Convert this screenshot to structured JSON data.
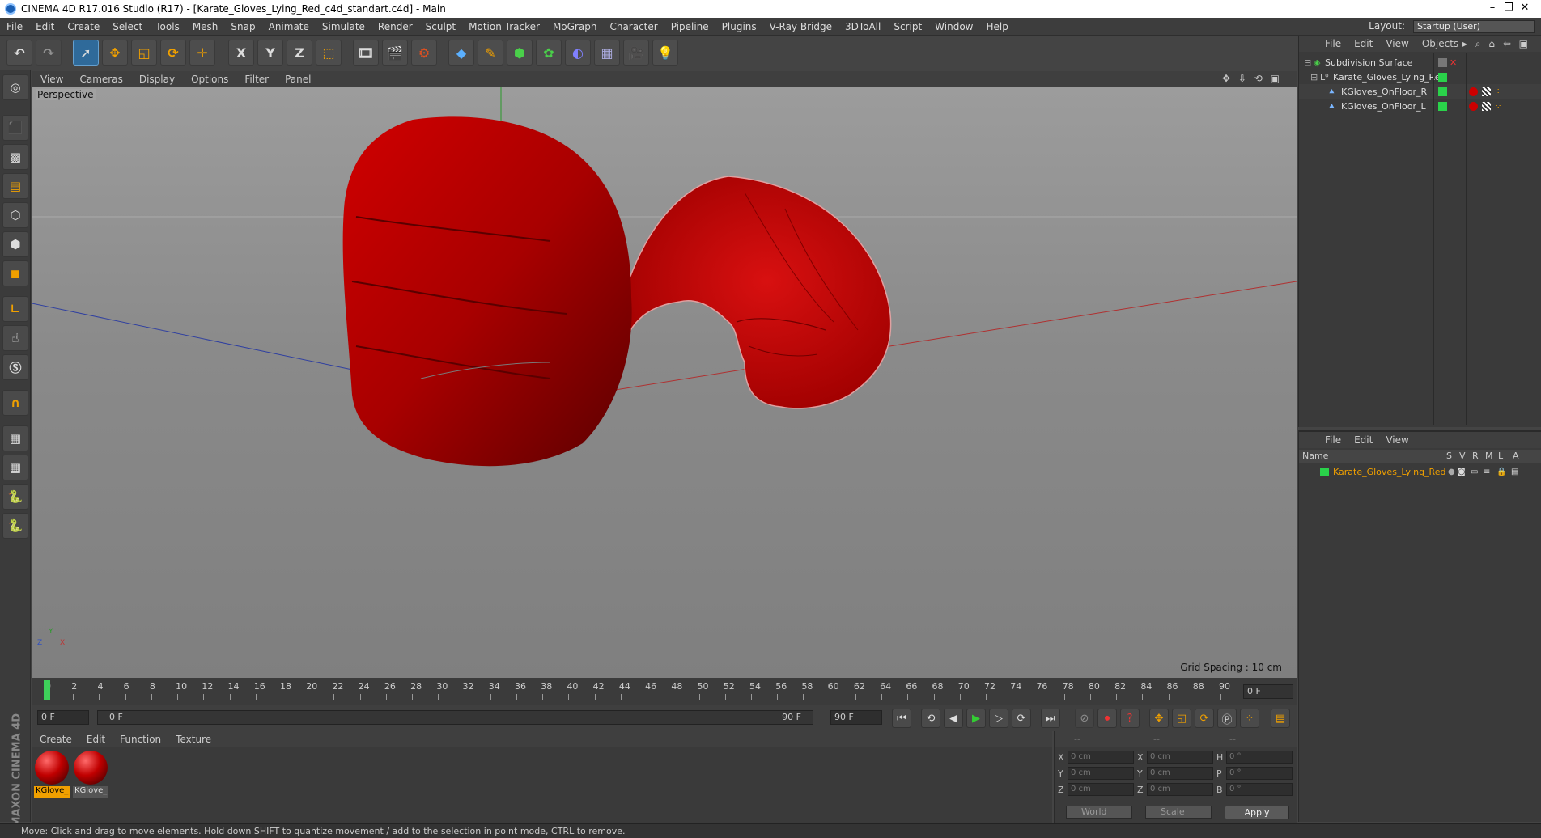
{
  "window": {
    "title": "CINEMA 4D R17.016 Studio (R17) - [Karate_Gloves_Lying_Red_c4d_standart.c4d] - Main",
    "controls": [
      "–",
      "❐",
      "✕"
    ]
  },
  "menubar": {
    "items": [
      "File",
      "Edit",
      "Create",
      "Select",
      "Tools",
      "Mesh",
      "Snap",
      "Animate",
      "Simulate",
      "Render",
      "Sculpt",
      "Motion Tracker",
      "MoGraph",
      "Character",
      "Pipeline",
      "Plugins",
      "V-Ray Bridge",
      "3DToAll",
      "Script",
      "Window",
      "Help"
    ],
    "layout_label": "Layout:",
    "layout_value": "Startup (User)"
  },
  "toolbar": {
    "axis_x": "X",
    "axis_y": "Y",
    "axis_z": "Z"
  },
  "viewport": {
    "menu": [
      "View",
      "Cameras",
      "Display",
      "Options",
      "Filter",
      "Panel"
    ],
    "nav_icons": "✥ ⇩ ⟲ ▣",
    "label": "Perspective",
    "grid_spacing": "Grid Spacing : 10 cm",
    "object_color": "#c00000",
    "axis_labels": {
      "y": "Y",
      "z": "Z",
      "x": "X"
    }
  },
  "timeline": {
    "ticks": [
      0,
      2,
      4,
      6,
      8,
      10,
      12,
      14,
      16,
      18,
      20,
      22,
      24,
      26,
      28,
      30,
      32,
      34,
      36,
      38,
      40,
      42,
      44,
      46,
      48,
      50,
      52,
      54,
      56,
      58,
      60,
      62,
      64,
      66,
      68,
      70,
      72,
      74,
      76,
      78,
      80,
      82,
      84,
      86,
      88,
      90
    ],
    "current_frame": "0 F",
    "start_field": "0 F",
    "range_start": "0 F",
    "range_end": "90 F",
    "end_field": "90 F"
  },
  "materials": {
    "menu": [
      "Create",
      "Edit",
      "Function",
      "Texture"
    ],
    "items": [
      {
        "name": "KGlove_",
        "selected": true
      },
      {
        "name": "KGlove_",
        "selected": false
      }
    ],
    "brand": "MAXON CINEMA 4D"
  },
  "coordinates": {
    "header": [
      "--",
      "--",
      "--"
    ],
    "rows": [
      {
        "a": "X",
        "av": "0 cm",
        "b": "X",
        "bv": "0 cm",
        "c": "H",
        "cv": "0 °"
      },
      {
        "a": "Y",
        "av": "0 cm",
        "b": "Y",
        "bv": "0 cm",
        "c": "P",
        "cv": "0 °"
      },
      {
        "a": "Z",
        "av": "0 cm",
        "b": "Z",
        "bv": "0 cm",
        "c": "B",
        "cv": "0 °"
      }
    ],
    "space": "World",
    "mode": "Scale",
    "apply": "Apply"
  },
  "objects": {
    "menu": [
      "File",
      "Edit",
      "View",
      "Objects"
    ],
    "tree": [
      {
        "name": "Subdivision Surface",
        "indent": 0
      },
      {
        "name": "Karate_Gloves_Lying_Re",
        "indent": 1
      },
      {
        "name": "KGloves_OnFloor_R",
        "indent": 2
      },
      {
        "name": "KGloves_OnFloor_L",
        "indent": 2
      }
    ]
  },
  "layers": {
    "menu": [
      "File",
      "Edit",
      "View"
    ],
    "columns": {
      "name": "Name",
      "s": "S",
      "v": "V",
      "r": "R",
      "m": "M",
      "l": "L",
      "a": "A"
    },
    "items": [
      {
        "name": "Karate_Gloves_Lying_Red",
        "color": "#2ad24a"
      }
    ]
  },
  "status": {
    "text": "Move: Click and drag to move elements. Hold down SHIFT to quantize movement / add to the selection in point mode, CTRL to remove."
  }
}
